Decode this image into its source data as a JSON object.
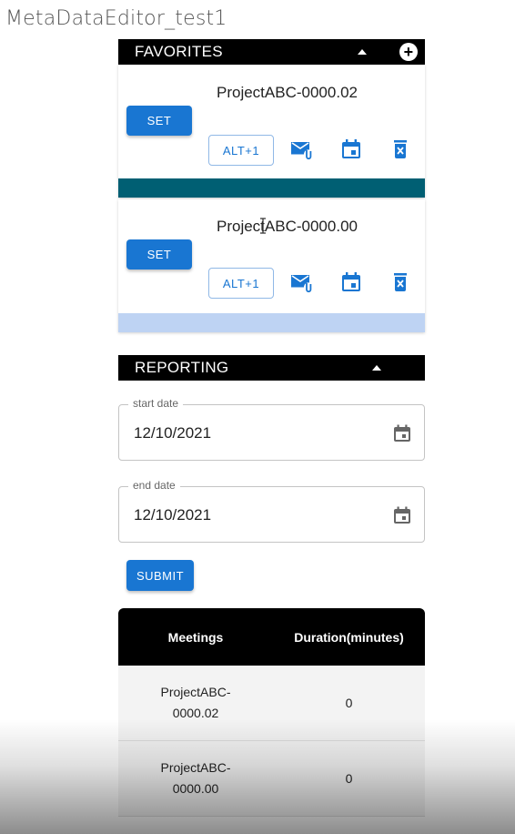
{
  "app": {
    "title": "MetaDataEditor_test1"
  },
  "favorites": {
    "header": "FAVORITES",
    "items": [
      {
        "name": "ProjectABC-0000.02",
        "set_label": "SET",
        "shortcut": "ALT+1",
        "bar_color": "#005f73"
      },
      {
        "name": "ProjectABC-0000.00",
        "set_label": "SET",
        "shortcut": "ALT+1",
        "bar_color": "#bed3f3"
      }
    ]
  },
  "reporting": {
    "header": "REPORTING",
    "start_date": {
      "label": "start date",
      "value": "12/10/2021"
    },
    "end_date": {
      "label": "end date",
      "value": "12/10/2021"
    },
    "submit_label": "SUBMIT",
    "table": {
      "columns": [
        "Meetings",
        "Duration(minutes)"
      ],
      "rows": [
        {
          "meeting_line1": "ProjectABC-",
          "meeting_line2": "0000.02",
          "duration": "0"
        },
        {
          "meeting_line1": "ProjectABC-",
          "meeting_line2": "0000.00",
          "duration": "0"
        }
      ]
    }
  },
  "colors": {
    "primary": "#1976d2",
    "header_bg": "#000000"
  }
}
